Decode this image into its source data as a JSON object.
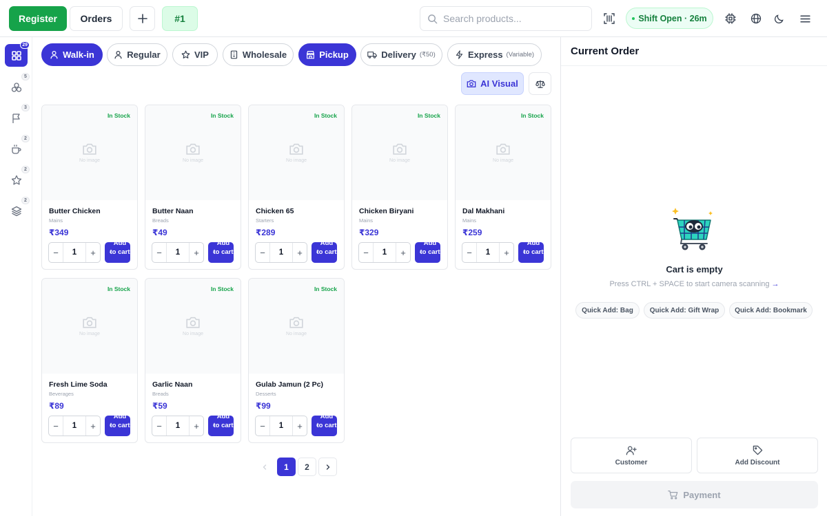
{
  "topbar": {
    "register_label": "Register",
    "orders_label": "Orders",
    "tab_label": "#1",
    "search_placeholder": "Search products...",
    "shift_label": "Shift Open · 26m"
  },
  "sidebar": {
    "items": [
      {
        "name": "all",
        "icon": "grid-icon",
        "count": "29"
      },
      {
        "name": "starters",
        "icon": "bubbles-icon",
        "count": "5"
      },
      {
        "name": "flags",
        "icon": "flag-icon",
        "count": "3"
      },
      {
        "name": "beverages",
        "icon": "coffee-icon",
        "count": "2"
      },
      {
        "name": "favorites",
        "icon": "star-icon",
        "count": "2"
      },
      {
        "name": "layers",
        "icon": "layers-icon",
        "count": "2"
      }
    ]
  },
  "customer_types": [
    {
      "label": "Walk-in",
      "note": "",
      "icon": "user-icon"
    },
    {
      "label": "Regular",
      "note": "",
      "icon": "user-icon"
    },
    {
      "label": "VIP",
      "note": "",
      "icon": "star-icon"
    },
    {
      "label": "Wholesale",
      "note": "",
      "icon": "building-icon"
    },
    {
      "label": "Pickup",
      "note": "",
      "icon": "store-icon"
    },
    {
      "label": "Delivery",
      "note": "(₹50)",
      "icon": "truck-icon"
    },
    {
      "label": "Express",
      "note": "(Variable)",
      "icon": "zap-icon"
    }
  ],
  "ai_visual_label": "AI Visual",
  "products": [
    {
      "name": "Butter Chicken",
      "category": "Mains",
      "price": "₹349",
      "stock": "In Stock",
      "qty": "1",
      "add_label": "Add to cart",
      "no_image": "No image"
    },
    {
      "name": "Butter Naan",
      "category": "Breads",
      "price": "₹49",
      "stock": "In Stock",
      "qty": "1",
      "add_label": "Add to cart",
      "no_image": "No image"
    },
    {
      "name": "Chicken 65",
      "category": "Starters",
      "price": "₹289",
      "stock": "In Stock",
      "qty": "1",
      "add_label": "Add to cart",
      "no_image": "No image"
    },
    {
      "name": "Chicken Biryani",
      "category": "Mains",
      "price": "₹329",
      "stock": "In Stock",
      "qty": "1",
      "add_label": "Add to cart",
      "no_image": "No image"
    },
    {
      "name": "Dal Makhani",
      "category": "Mains",
      "price": "₹259",
      "stock": "In Stock",
      "qty": "1",
      "add_label": "Add to cart",
      "no_image": "No image"
    },
    {
      "name": "Fresh Lime Soda",
      "category": "Beverages",
      "price": "₹89",
      "stock": "In Stock",
      "qty": "1",
      "add_label": "Add to cart",
      "no_image": "No image"
    },
    {
      "name": "Garlic Naan",
      "category": "Breads",
      "price": "₹59",
      "stock": "In Stock",
      "qty": "1",
      "add_label": "Add to cart",
      "no_image": "No image"
    },
    {
      "name": "Gulab Jamun (2 Pc)",
      "category": "Desserts",
      "price": "₹99",
      "stock": "In Stock",
      "qty": "1",
      "add_label": "Add to cart",
      "no_image": "No image"
    }
  ],
  "pagination": {
    "pages": [
      "1",
      "2"
    ],
    "current": "1"
  },
  "order": {
    "title": "Current Order",
    "empty_title": "Cart is empty",
    "empty_hint": "Press CTRL + SPACE to start camera scanning",
    "hint_arrow": "→",
    "quick_adds": [
      "Quick Add: Bag",
      "Quick Add: Gift Wrap",
      "Quick Add: Bookmark"
    ],
    "customer_label": "Customer",
    "discount_label": "Add Discount",
    "payment_label": "Payment"
  },
  "colors": {
    "primary": "#3b35d6",
    "register_green": "#16a34a",
    "stock_green": "#16a34a"
  }
}
